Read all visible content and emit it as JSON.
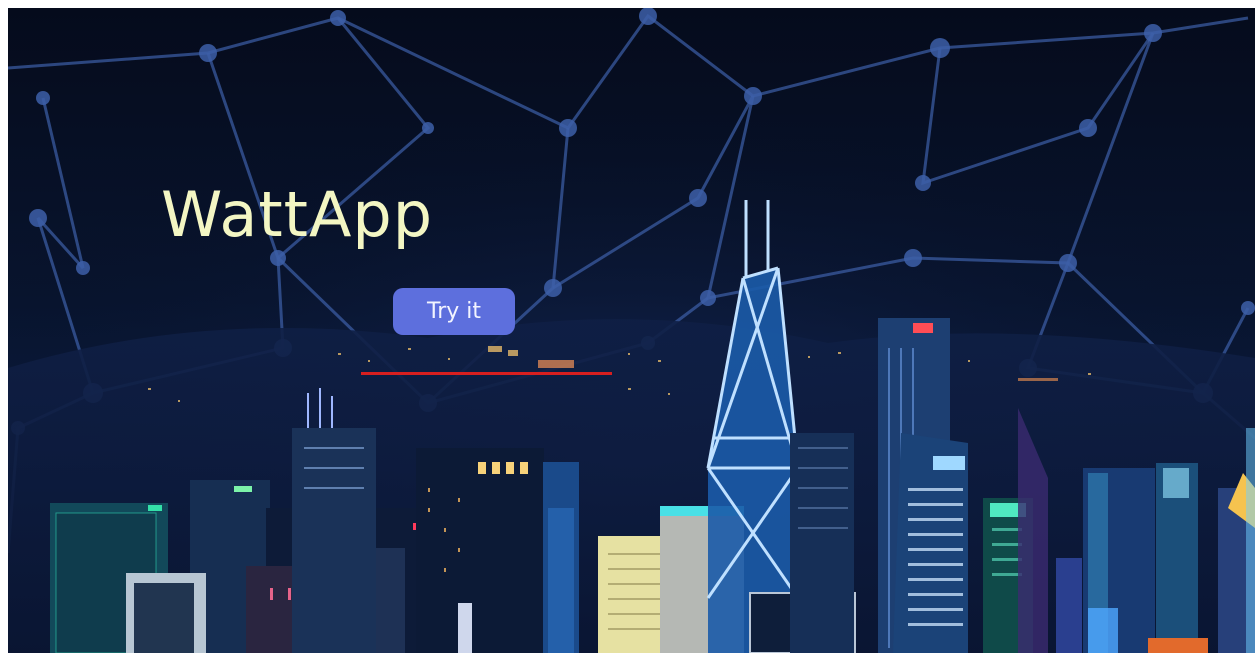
{
  "hero": {
    "title": "WattApp",
    "cta_label": "Try it"
  },
  "colors": {
    "title": "#f3f6c3",
    "button": "#5d6fdd",
    "underline": "#d71f1f",
    "sky": "#050b1c"
  },
  "icons": [
    "network-graph-icon",
    "city-skyline-icon"
  ]
}
